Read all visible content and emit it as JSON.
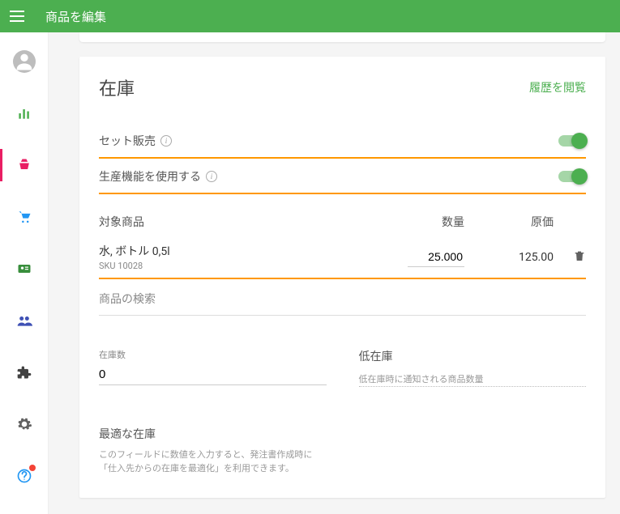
{
  "header": {
    "title": "商品を編集"
  },
  "card": {
    "title": "在庫",
    "history_link": "履歴を閲覧",
    "toggle_set_sale": "セット販売",
    "toggle_production": "生産機能を使用する",
    "columns": {
      "name": "対象商品",
      "qty": "数量",
      "cost": "原価"
    },
    "item": {
      "name": "水, ボトル 0,5l",
      "sku": "SKU 10028",
      "qty": "25.000",
      "cost": "125.00"
    },
    "search_placeholder": "商品の検索",
    "stock_field": {
      "label": "在庫数",
      "value": "0"
    },
    "low_stock_field": {
      "label": "低在庫",
      "helper": "低在庫時に通知される商品数量"
    },
    "optimal_field": {
      "label": "最適な在庫",
      "helper": "このフィールドに数値を入力すると、発注書作成時に「仕入先からの在庫を最適化」を利用できます。"
    }
  }
}
